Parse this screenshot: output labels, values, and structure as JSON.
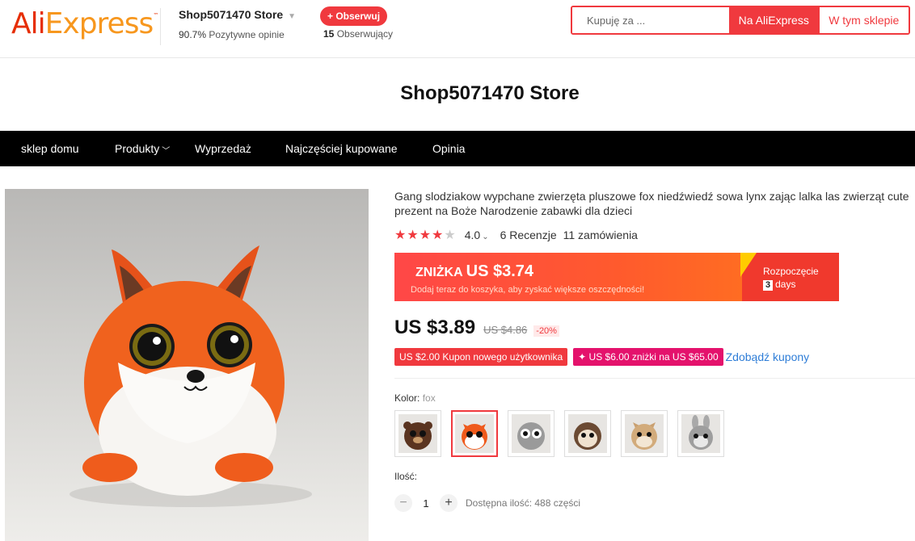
{
  "header": {
    "logo": {
      "ali": "Ali",
      "express": "Express",
      "tm": "™"
    },
    "store_name": "Shop5071470 Store",
    "positive_value": "90.7%",
    "positive_label": "Pozytywne opinie",
    "follow_label": "+ Obserwuj",
    "followers_count": "15",
    "followers_label": "Obserwujący",
    "search_placeholder": "Kupuję za ...",
    "search_ali_label": "Na AliExpress",
    "search_store_label": "W tym sklepie"
  },
  "banner": {
    "title": "Shop5071470 Store"
  },
  "nav": {
    "items": [
      "sklep domu",
      "Produkty",
      "Wyprzedaż",
      "Najczęściej kupowane",
      "Opinia"
    ]
  },
  "product": {
    "title": "Gang slodziakow wypchane zwierzęta pluszowe fox niedźwiedź sowa lynx zając lalka las zwierząt cute prezent na Boże Narodzenie zabawki dla dzieci",
    "rating": "4.0",
    "reviews": "6 Recenzje",
    "orders": "11 zamówienia",
    "promo": {
      "label": "ZNIŻKA",
      "amount": "US $3.74",
      "sub": "Dodaj teraz do koszyka, aby zyskać większe oszczędności!",
      "start_label": "Rozpoczęcie",
      "days_num": "3",
      "days_label": "days"
    },
    "price": "US $3.89",
    "old_price": "US $4.86",
    "discount": "-20%",
    "coupons": [
      "US $2.00 Kupon nowego użytkownika",
      "✦ US $6.00 zniżki na US $65.00"
    ],
    "coupon_link": "Zdobądź kupony",
    "color_label": "Kolor:",
    "color_value": "fox",
    "qty_label": "Ilość:",
    "qty_value": "1",
    "availability": "Dostępna ilość: 488 części",
    "bottom_fragment": "· · · · · · ·"
  },
  "colors": {
    "accent": "#f0393e",
    "nav_bg": "#000000",
    "link": "#2e7dd7"
  },
  "icons": [
    "chevron-down-icon",
    "star-icon",
    "minus-icon",
    "plus-icon"
  ]
}
